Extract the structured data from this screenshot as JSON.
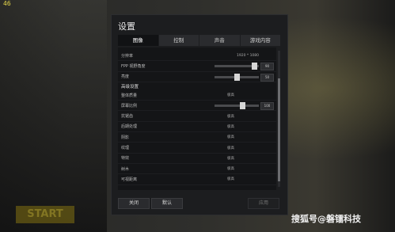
{
  "fps": "46",
  "start_label": "START",
  "dialog": {
    "title": "设置",
    "tabs": [
      {
        "label": "图像",
        "active": true
      },
      {
        "label": "控制",
        "active": false
      },
      {
        "label": "声音",
        "active": false
      },
      {
        "label": "游戏内容",
        "active": false
      }
    ]
  },
  "settings": {
    "resolution": {
      "label": "分辨率",
      "value": "1920 * 1080"
    },
    "fpp_fov": {
      "label": "FPP 视野角度",
      "value": "90",
      "level": 0.85
    },
    "brightness": {
      "label": "亮度",
      "value": "50",
      "level": 0.5
    },
    "advanced_header": "高级设置",
    "overall_quality": {
      "label": "整体质量",
      "value": "极高"
    },
    "screen_scale": {
      "label": "屏幕比例",
      "value": "100",
      "level": 0.6
    },
    "anti_aliasing": {
      "label": "抗锯齿",
      "value": "极高"
    },
    "post_processing": {
      "label": "后期处理",
      "value": "极高"
    },
    "shadows": {
      "label": "阴影",
      "value": "极高"
    },
    "textures": {
      "label": "纹理",
      "value": "极高"
    },
    "effects": {
      "label": "特效",
      "value": "极高"
    },
    "foliage": {
      "label": "树木",
      "value": "极高"
    },
    "view_distance": {
      "label": "可视距离",
      "value": "极高"
    }
  },
  "footer": {
    "close_label": "关闭",
    "default_label": "默认",
    "apply_label": "应用"
  },
  "watermark": "搜狐号@磐镭科技"
}
